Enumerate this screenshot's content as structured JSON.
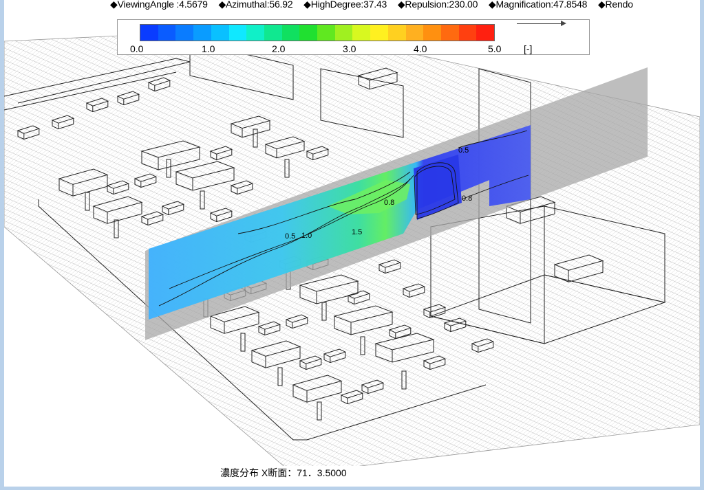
{
  "params": {
    "items": [
      "◆ViewingAngle :4.5679",
      "◆Azimuthal:56.92",
      "◆HighDegree:37.43",
      "◆Repulsion:230.00",
      "◆Magnification:47.8548",
      "◆Rendo"
    ]
  },
  "legend": {
    "ticks": [
      "0.0",
      "1.0",
      "2.0",
      "3.0",
      "4.0",
      "5.0"
    ],
    "unit": "[-]",
    "colors": [
      "#0a3cff",
      "#0a5cff",
      "#0a7cff",
      "#0a9cff",
      "#0ac0ff",
      "#10e8ff",
      "#10f0c8",
      "#10e890",
      "#10e060",
      "#20e030",
      "#60e820",
      "#a0f020",
      "#d8f820",
      "#fff020",
      "#ffd020",
      "#ffb020",
      "#ff9010",
      "#ff6a10",
      "#ff4010",
      "#ff2010"
    ]
  },
  "contours": {
    "labels": [
      "0.5",
      "0.8",
      "1.0",
      "1.5",
      "0.5",
      "0.8",
      "0.5",
      "1.0"
    ]
  },
  "caption": {
    "text": "濃度分布 X断面：71．3.5000"
  }
}
